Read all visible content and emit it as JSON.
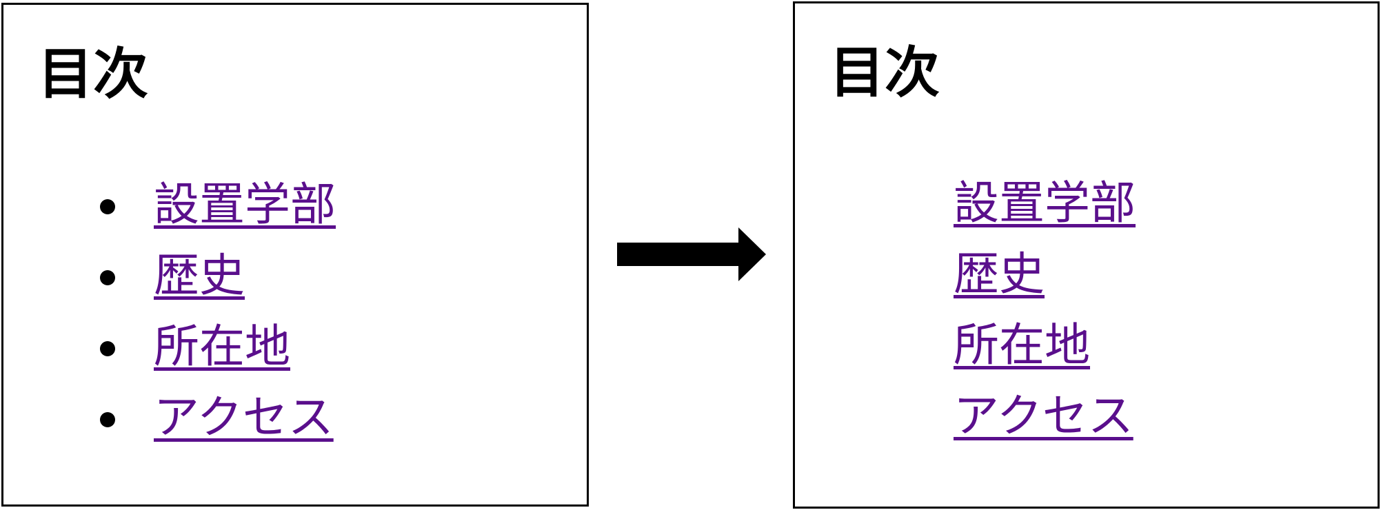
{
  "before_panel": {
    "title": "目次",
    "items": [
      {
        "label": "設置学部"
      },
      {
        "label": "歴史"
      },
      {
        "label": "所在地"
      },
      {
        "label": "アクセス"
      }
    ]
  },
  "after_panel": {
    "title": "目次",
    "items": [
      {
        "label": "設置学部"
      },
      {
        "label": "歴史"
      },
      {
        "label": "所在地"
      },
      {
        "label": "アクセス"
      }
    ]
  },
  "colors": {
    "link": "#5a0f8c",
    "border": "#000000",
    "arrow": "#000000"
  },
  "icons": {
    "transition": "right-arrow-icon",
    "list_marker": "bullet-icon"
  }
}
